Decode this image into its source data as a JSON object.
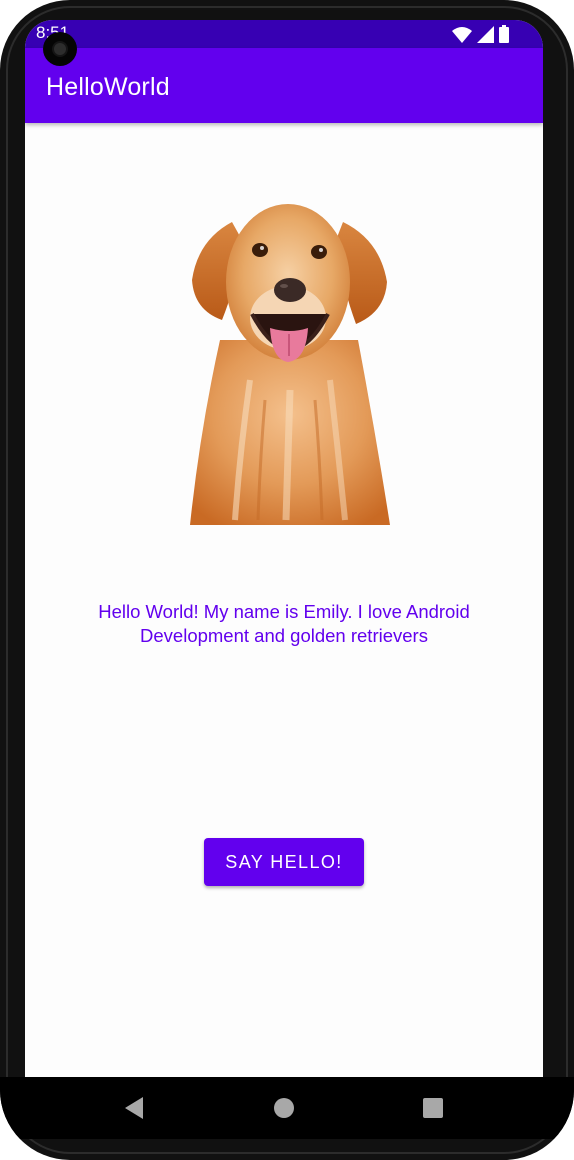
{
  "status_bar": {
    "time": "8:51",
    "icons": [
      "wifi-icon",
      "signal-icon",
      "battery-icon"
    ],
    "background": "#3700b3"
  },
  "app_bar": {
    "title": "HelloWorld",
    "background": "#6200ee"
  },
  "main": {
    "image": "golden-retriever-photo",
    "message": "Hello World! My name is Emily. I love Android Development and golden retrievers",
    "message_color": "#6200ee",
    "button_label": "SAY HELLO!",
    "button_color": "#6200ee"
  },
  "nav_bar": {
    "buttons": [
      "back-icon",
      "home-icon",
      "recents-icon"
    ]
  }
}
